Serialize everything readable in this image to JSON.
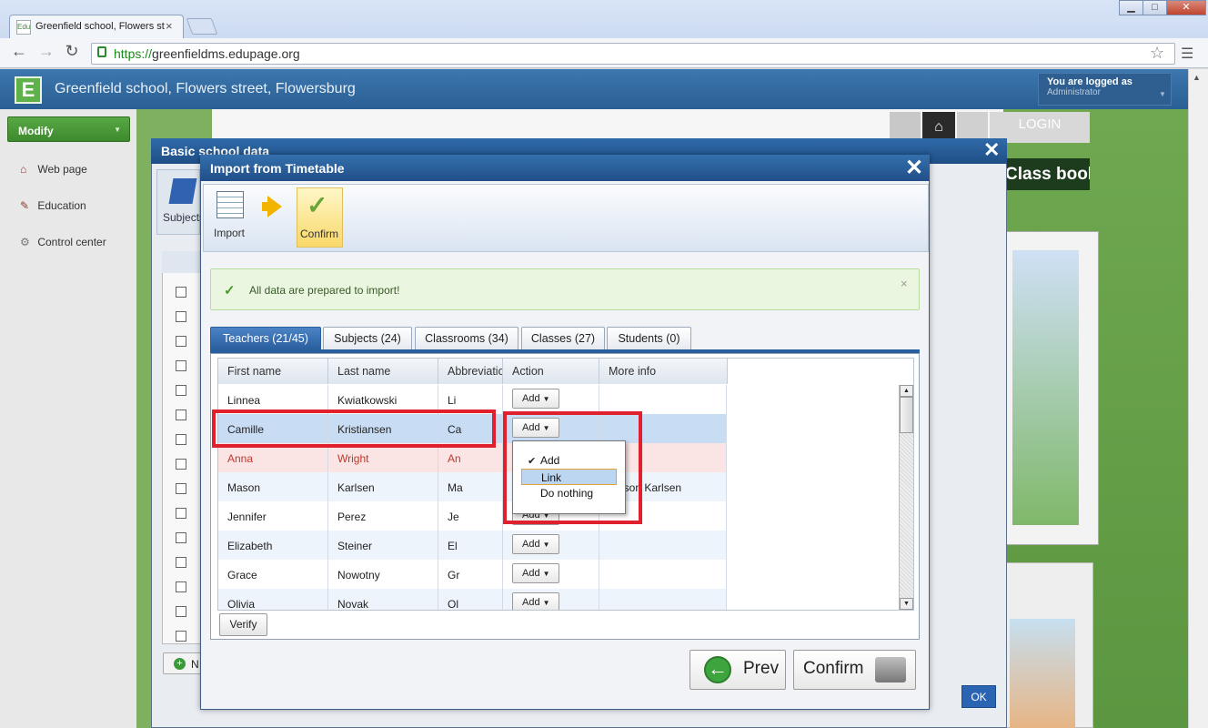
{
  "browser": {
    "tab_title": "Greenfield school, Flowers st",
    "tab_favicon": "Edu",
    "url_scheme": "https://",
    "url_host": "greenfieldms.edupage.org",
    "window_minimize": "▁",
    "window_maximize": "□",
    "window_close": "✕"
  },
  "app": {
    "logo_letter": "E",
    "title": "Greenfield school, Flowers street, Flowersburg",
    "logged_label": "You are logged as",
    "logged_user": "Administrator"
  },
  "sidebar": {
    "modify_label": "Modify",
    "items": [
      {
        "label": "Web page",
        "icon": "house-icon"
      },
      {
        "label": "Education",
        "icon": "education-icon"
      },
      {
        "label": "Control center",
        "icon": "gear-icon"
      }
    ]
  },
  "background": {
    "login_label": "LOGIN",
    "classbook_label": "Class book"
  },
  "outer_dialog": {
    "title": "Basic school data",
    "toolbar_subjects": "Subjects",
    "new_button": "N",
    "ok_label": "OK"
  },
  "dialog": {
    "title": "Import from Timetable",
    "steps": [
      {
        "label": "Import",
        "icon": "spreadsheet-icon"
      },
      {
        "label": "Confirm",
        "icon": "checkmark-icon"
      }
    ],
    "alert_text": "All data are prepared to import!",
    "tabs": [
      {
        "label": "Teachers (21/45)",
        "active": true
      },
      {
        "label": "Subjects (24)"
      },
      {
        "label": "Classrooms (34)"
      },
      {
        "label": "Classes (27)"
      },
      {
        "label": "Students (0)"
      }
    ],
    "columns": [
      "First name",
      "Last name",
      "Abbreviation",
      "Action",
      "More info"
    ],
    "rows": [
      {
        "first": "Linnea",
        "last": "Kwiatkowski",
        "abbr": "Li",
        "action": "Add",
        "info": ""
      },
      {
        "first": "Camille",
        "last": "Kristiansen",
        "abbr": "Ca",
        "action": "Add",
        "info": ""
      },
      {
        "first": "Anna",
        "last": "Wright",
        "abbr": "An",
        "action": "",
        "info": ""
      },
      {
        "first": "Mason",
        "last": "Karlsen",
        "abbr": "Ma",
        "action": "",
        "info": "Mason Karlsen"
      },
      {
        "first": "Jennifer",
        "last": "Perez",
        "abbr": "Je",
        "action": "Add",
        "info": ""
      },
      {
        "first": "Elizabeth",
        "last": "Steiner",
        "abbr": "El",
        "action": "Add",
        "info": ""
      },
      {
        "first": "Grace",
        "last": "Nowotny",
        "abbr": "Gr",
        "action": "Add",
        "info": ""
      },
      {
        "first": "Olivia",
        "last": "Novak",
        "abbr": "Ol",
        "action": "Add",
        "info": ""
      }
    ],
    "dropdown": {
      "options": [
        "Add",
        "Link",
        "Do nothing"
      ],
      "checked": "Add",
      "highlighted": "Link"
    },
    "verify_label": "Verify",
    "prev_label": "Prev",
    "confirm_label": "Confirm",
    "colors": {
      "accent": "#2a5f9e",
      "highlight_box": "#e0202c",
      "conflict_row": "#fbe4e4",
      "conflict_text": "#c0392b"
    }
  }
}
